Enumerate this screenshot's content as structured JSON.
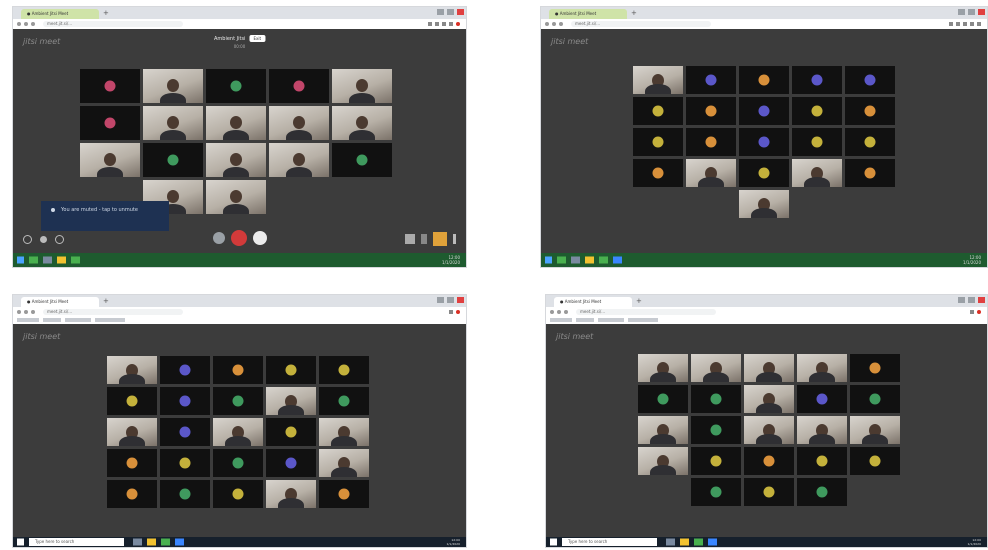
{
  "panels": [
    {
      "id": "p1",
      "tab_title": "● Ambient Jitsi Meet",
      "tab_style": "green",
      "address": "meet.jit.si/...",
      "logo": "jitsi meet",
      "meeting_title": "Ambient Jitsi",
      "meeting_button": "Exit",
      "meeting_sub": "00:00",
      "chip_text": "You are muted - tap to unmute",
      "taskbar_style": "win8",
      "clock": [
        "12:00",
        "1/1/2020"
      ],
      "rows": [
        [
          "r",
          "v",
          "g",
          "r",
          "v"
        ],
        [
          "r",
          "v",
          "v",
          "v",
          "v"
        ],
        [
          "v",
          "g",
          "v",
          "v",
          "g"
        ],
        [
          "v",
          "v"
        ]
      ]
    },
    {
      "id": "p2",
      "tab_title": "● Ambient Jitsi Meet",
      "tab_style": "green",
      "address": "meet.jit.si/...",
      "logo": "jitsi meet",
      "taskbar_style": "win8",
      "clock": [
        "12:00",
        "1/1/2020"
      ],
      "rows": [
        [
          "v",
          "p",
          "o",
          "p",
          "p"
        ],
        [
          "y",
          "o",
          "p",
          "y",
          "o"
        ],
        [
          "y",
          "o",
          "p",
          "y",
          "y"
        ],
        [
          "o",
          "v",
          "y",
          "v",
          "o"
        ],
        [
          "v"
        ]
      ]
    },
    {
      "id": "p3",
      "tab_title": "● Ambient Jitsi Meet",
      "tab_style": "white",
      "address": "meet.jit.si/...",
      "logo": "jitsi meet",
      "taskbar_style": "win10",
      "search_placeholder": "Type here to search",
      "clock": [
        "12:00",
        "1/1/2020"
      ],
      "rows": [
        [
          "v",
          "p",
          "o",
          "y",
          "y"
        ],
        [
          "y",
          "p",
          "g",
          "v",
          "g"
        ],
        [
          "v",
          "p",
          "v",
          "y",
          "v"
        ],
        [
          "o",
          "y",
          "g",
          "p",
          "v"
        ],
        [
          "o",
          "g",
          "y",
          "v",
          "o"
        ]
      ]
    },
    {
      "id": "p4",
      "tab_title": "● Ambient Jitsi Meet",
      "tab_style": "white",
      "address": "meet.jit.si/...",
      "logo": "jitsi meet",
      "taskbar_style": "win10",
      "search_placeholder": "Type here to search",
      "clock": [
        "12:00",
        "1/1/2020"
      ],
      "rows": [
        [
          "v",
          "v",
          "v",
          "v",
          "o"
        ],
        [
          "g",
          "g",
          "v",
          "p",
          "g"
        ],
        [
          "v",
          "g",
          "v",
          "v",
          "v"
        ],
        [
          "v",
          "y",
          "o",
          "y",
          "y"
        ],
        [
          "g",
          "y",
          "g"
        ]
      ]
    }
  ],
  "avatar_colors": {
    "r": "#c2466a",
    "g": "#3f9a5e",
    "p": "#5b57c9",
    "o": "#d8903a",
    "y": "#c4b13b"
  }
}
